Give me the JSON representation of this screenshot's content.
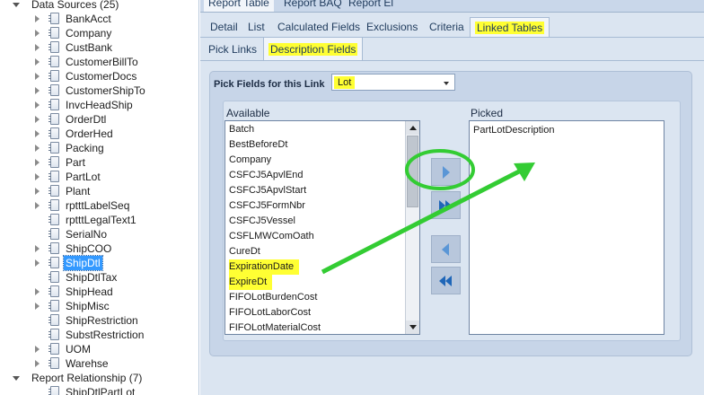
{
  "colors": {
    "highlight": "#ffff33",
    "annotation": "#33cc33",
    "selection": "#3399ff",
    "panel": "#dbe5f1"
  },
  "tree": {
    "data_sources_label": "Data Sources (25)",
    "items": [
      {
        "label": "BankAcct",
        "expandable": true
      },
      {
        "label": "Company",
        "expandable": true
      },
      {
        "label": "CustBank",
        "expandable": true
      },
      {
        "label": "CustomerBillTo",
        "expandable": true
      },
      {
        "label": "CustomerDocs",
        "expandable": true
      },
      {
        "label": "CustomerShipTo",
        "expandable": true
      },
      {
        "label": "InvcHeadShip",
        "expandable": true
      },
      {
        "label": "OrderDtl",
        "expandable": true
      },
      {
        "label": "OrderHed",
        "expandable": true
      },
      {
        "label": "Packing",
        "expandable": true
      },
      {
        "label": "Part",
        "expandable": true
      },
      {
        "label": "PartLot",
        "expandable": true
      },
      {
        "label": "Plant",
        "expandable": true
      },
      {
        "label": "rptttLabelSeq",
        "expandable": true
      },
      {
        "label": "rptttLegalText1",
        "expandable": false
      },
      {
        "label": "SerialNo",
        "expandable": false
      },
      {
        "label": "ShipCOO",
        "expandable": true
      },
      {
        "label": "ShipDtl",
        "expandable": true,
        "selected": true
      },
      {
        "label": "ShipDtlTax",
        "expandable": false
      },
      {
        "label": "ShipHead",
        "expandable": true
      },
      {
        "label": "ShipMisc",
        "expandable": true
      },
      {
        "label": "ShipRestriction",
        "expandable": false
      },
      {
        "label": "SubstRestriction",
        "expandable": false
      },
      {
        "label": "UOM",
        "expandable": true
      },
      {
        "label": "Warehse",
        "expandable": true
      }
    ],
    "report_relationship_label": "Report Relationship (7)",
    "partial_item_label": "ShipDtlPartLot"
  },
  "top_tabs": [
    "Report Table",
    "Report BAQ",
    "Report El"
  ],
  "sub_tabs": [
    "Detail",
    "List",
    "Calculated Fields",
    "Exclusions",
    "Criteria",
    "Linked Tables"
  ],
  "sub_tabs2": [
    "Pick Links",
    "Description Fields"
  ],
  "pick": {
    "label": "Pick Fields for this Link",
    "selected_value": "Lot"
  },
  "available": {
    "label": "Available",
    "items": [
      {
        "label": "Batch",
        "highlighted": false
      },
      {
        "label": "BestBeforeDt",
        "highlighted": false
      },
      {
        "label": "Company",
        "highlighted": false
      },
      {
        "label": "CSFCJ5ApvlEnd",
        "highlighted": false
      },
      {
        "label": "CSFCJ5ApvlStart",
        "highlighted": false
      },
      {
        "label": "CSFCJ5FormNbr",
        "highlighted": false
      },
      {
        "label": "CSFCJ5Vessel",
        "highlighted": false
      },
      {
        "label": "CSFLMWComOath",
        "highlighted": false
      },
      {
        "label": "CureDt",
        "highlighted": false
      },
      {
        "label": "ExpirationDate",
        "highlighted": true
      },
      {
        "label": "ExpireDt",
        "highlighted": true
      },
      {
        "label": "FIFOLotBurdenCost",
        "highlighted": false
      },
      {
        "label": "FIFOLotLaborCost",
        "highlighted": false
      },
      {
        "label": "FIFOLotMaterialCost",
        "highlighted": false
      }
    ]
  },
  "picked": {
    "label": "Picked",
    "items": [
      "PartLotDescription"
    ]
  },
  "buttons": {
    "move_right": "move-right-icon",
    "move_all_right": "move-all-right-icon",
    "move_left": "move-left-icon",
    "move_all_left": "move-all-left-icon"
  }
}
